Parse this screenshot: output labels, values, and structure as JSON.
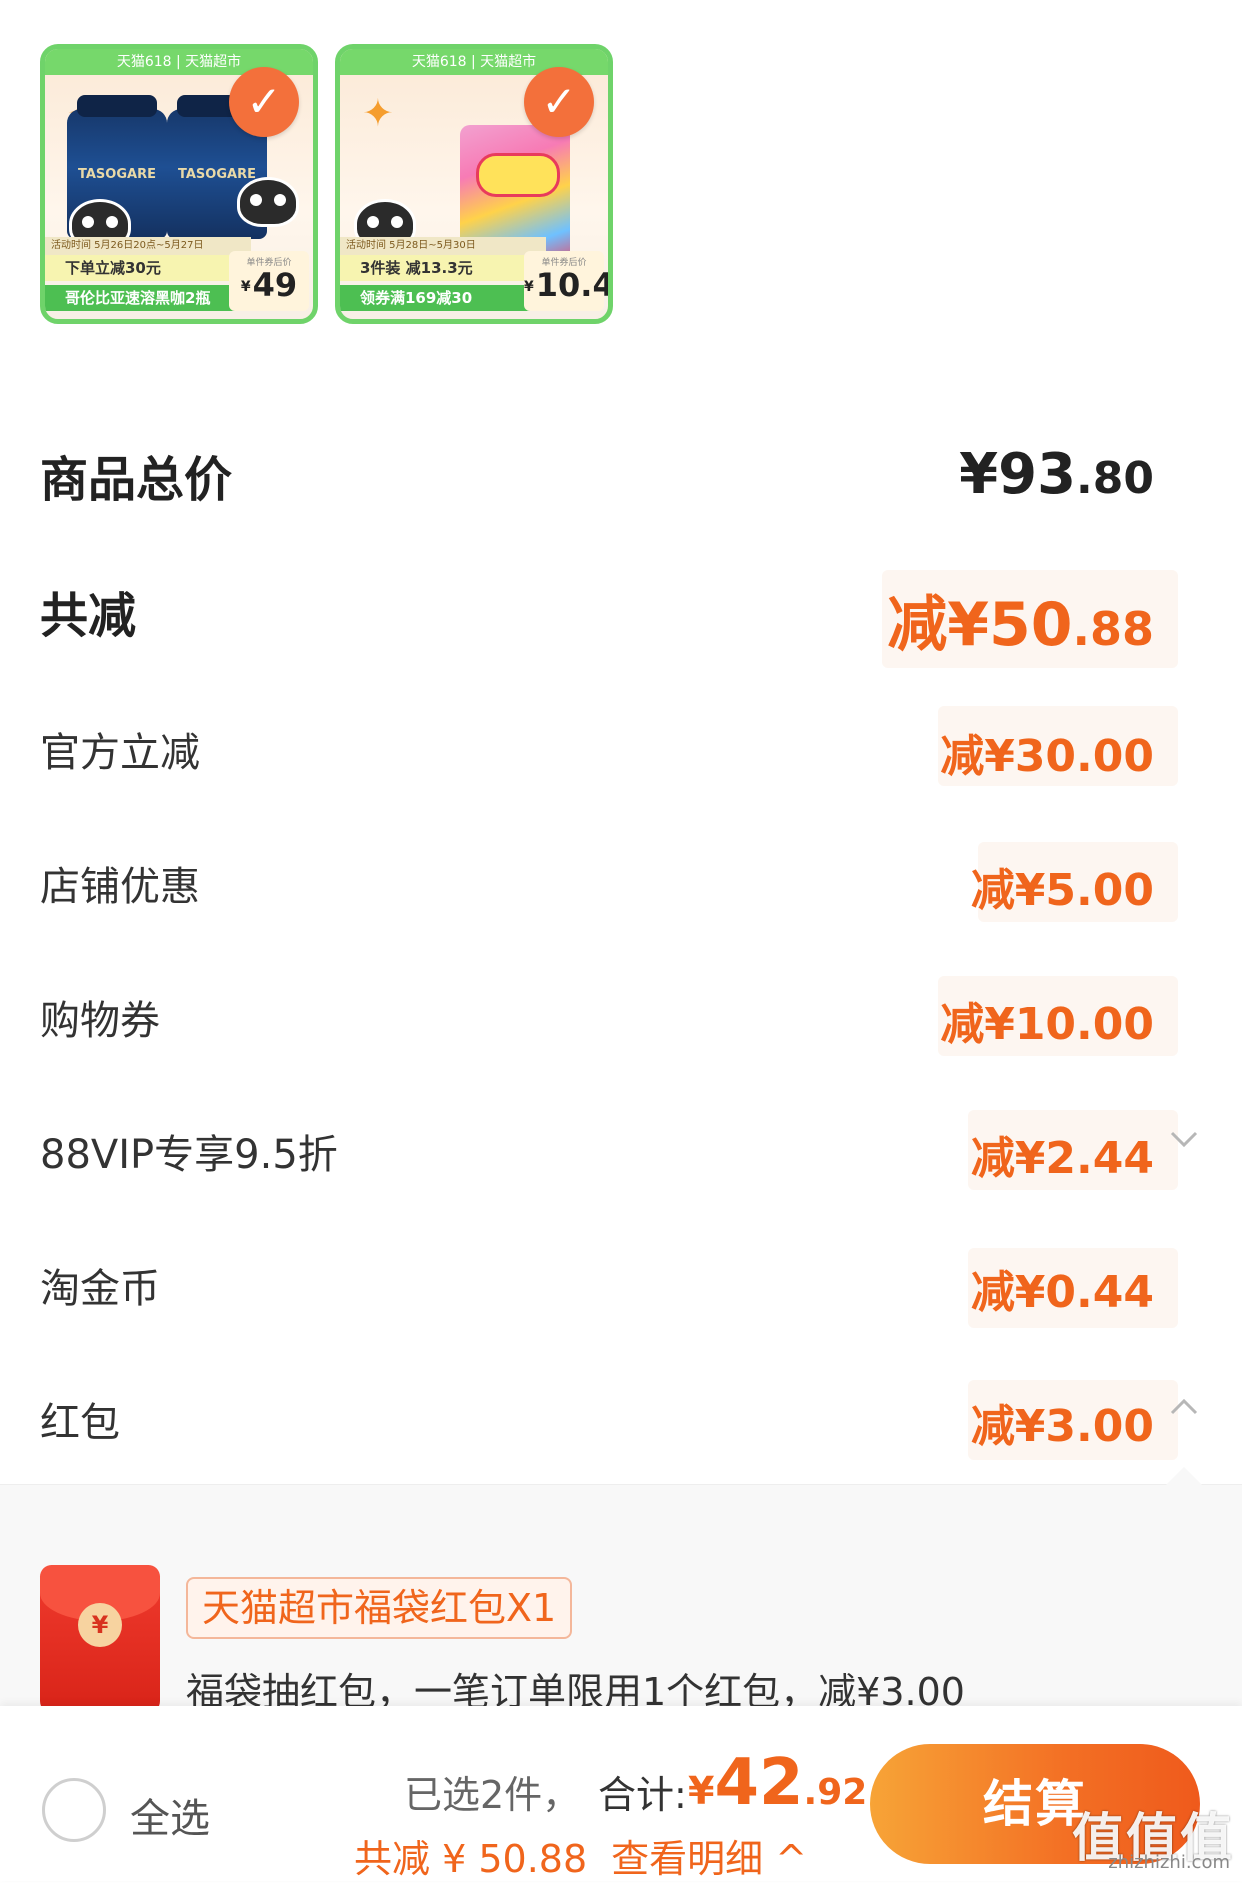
{
  "products": [
    {
      "banner": "天猫618 | 天猫超市",
      "jar_text": "TASOGARE",
      "event_text": "活动时间 5月26日20点~5月27日",
      "promo_a": "下单立减30元",
      "promo_b": "哥伦比亚速溶黑咖2瓶",
      "price_caption": "单件券后价",
      "price_symbol": "¥",
      "price": "49"
    },
    {
      "banner": "天猫618 | 天猫超市",
      "event_text": "活动时间 5月28日~5月30日",
      "promo_a": "3件装 减13.3元",
      "promo_b": "领券满169减30",
      "price_caption": "单件券后价",
      "price_symbol": "¥",
      "price": "10.4"
    }
  ],
  "summary": {
    "total_label": "商品总价",
    "total_int": "¥93",
    "total_dec": ".80",
    "saved_label": "共减",
    "saved_int": "减¥50",
    "saved_dec": ".88",
    "items": [
      {
        "label": "官方立减",
        "amount": "减¥30.00"
      },
      {
        "label": "店铺优惠",
        "amount": "减¥5.00"
      },
      {
        "label": "购物券",
        "amount": "减¥10.00"
      },
      {
        "label": "88VIP专享9.5折",
        "amount": "减¥2.44",
        "chevron": "chevron-down-icon"
      },
      {
        "label": "淘金币",
        "amount": "减¥0.44"
      },
      {
        "label": "红包",
        "amount": "减¥3.00",
        "chevron": "chevron-up-icon"
      }
    ]
  },
  "red_packet": {
    "icon_glyph": "¥",
    "title": "天猫超市福袋红包X1",
    "description": "福袋抽红包，一笔订单限用1个红包，减¥3.00"
  },
  "bottom_bar": {
    "select_all": "全选",
    "selected_count": "已选2件，",
    "sum_label": "合计:",
    "sum_symbol": "¥",
    "sum_int": "42",
    "sum_dec": ".92",
    "saved_prefix": "共减",
    "saved_amount": "¥ 50.88",
    "details_link": "查看明细",
    "details_icon": "^",
    "checkout": "结算"
  },
  "watermark": {
    "text": "值值值",
    "site": "zhizhizhi.com"
  },
  "colors": {
    "accent": "#f0651c",
    "green": "#6fd36a",
    "checkout_start": "#f7a437",
    "checkout_end": "#ef5a1c"
  }
}
